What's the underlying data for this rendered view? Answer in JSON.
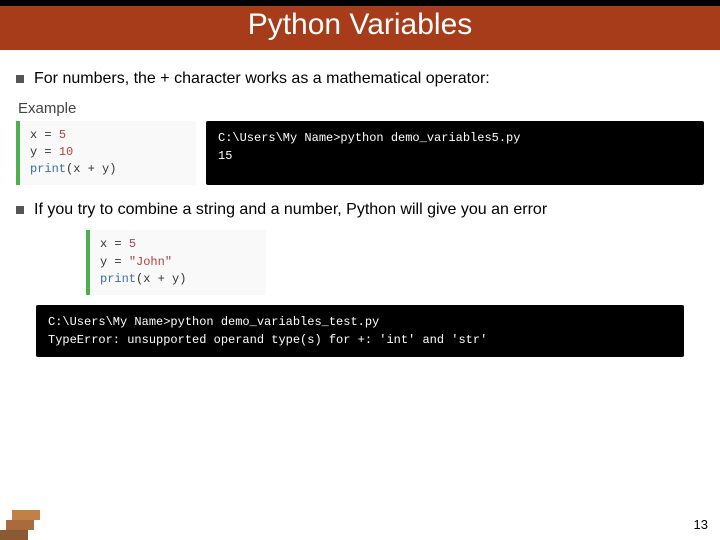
{
  "title": "Python Variables",
  "bullets": [
    "For numbers, the + character works as a mathematical operator:",
    "If you try to combine a string and a number, Python will give you an error"
  ],
  "example1": {
    "label": "Example",
    "code": {
      "l1a": "x = ",
      "l1b": "5",
      "l2a": "y = ",
      "l2b": "10",
      "l3a": "print",
      "l3b": "(x + y)"
    },
    "terminal": {
      "l1": "C:\\Users\\My Name>python demo_variables5.py",
      "l2": "15"
    }
  },
  "example2": {
    "code": {
      "l1a": "x = ",
      "l1b": "5",
      "l2a": "y = ",
      "l2b": "\"John\"",
      "l3a": "print",
      "l3b": "(x + y)"
    },
    "terminal": {
      "l1": "C:\\Users\\My Name>python demo_variables_test.py",
      "l2": "TypeError: unsupported operand type(s) for +: 'int' and 'str'"
    }
  },
  "page_number": "13"
}
